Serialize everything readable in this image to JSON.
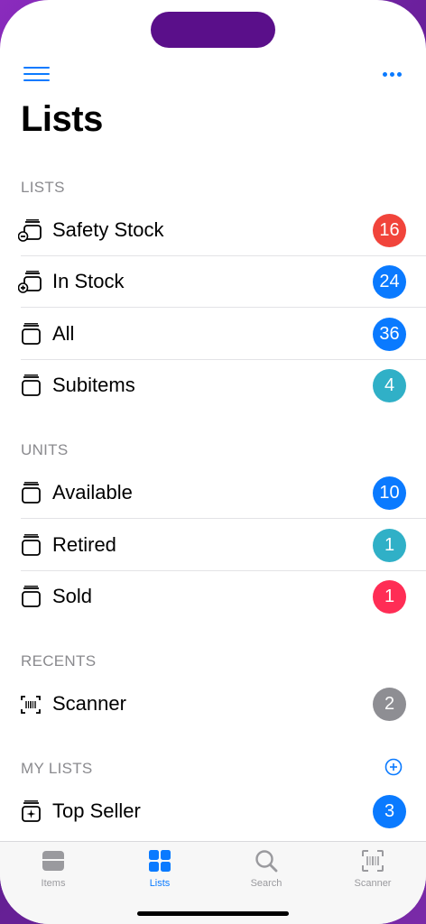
{
  "header": {
    "title": "Lists"
  },
  "sections": {
    "lists": {
      "header": "LISTS",
      "items": [
        {
          "label": "Safety Stock",
          "count": "16",
          "color": "#f1443b",
          "icon": "box-minus-icon"
        },
        {
          "label": "In Stock",
          "count": "24",
          "color": "#0a7aff",
          "icon": "box-plus-icon"
        },
        {
          "label": "All",
          "count": "36",
          "color": "#0a7aff",
          "icon": "box-icon"
        },
        {
          "label": "Subitems",
          "count": "4",
          "color": "#30b0c7",
          "icon": "box-icon"
        }
      ]
    },
    "units": {
      "header": "UNITS",
      "items": [
        {
          "label": "Available",
          "count": "10",
          "color": "#0a7aff",
          "icon": "box-icon"
        },
        {
          "label": "Retired",
          "count": "1",
          "color": "#30b0c7",
          "icon": "box-icon"
        },
        {
          "label": "Sold",
          "count": "1",
          "color": "#ff2d55",
          "icon": "box-icon"
        }
      ]
    },
    "recents": {
      "header": "RECENTS",
      "items": [
        {
          "label": "Scanner",
          "count": "2",
          "color": "#8e8e93",
          "icon": "barcode-scan-icon"
        }
      ]
    },
    "my_lists": {
      "header": "MY LISTS",
      "items": [
        {
          "label": "Top Seller",
          "count": "3",
          "color": "#0a7aff",
          "icon": "box-sparkle-icon"
        }
      ]
    }
  },
  "tabbar": {
    "tabs": [
      {
        "label": "Items",
        "active": false
      },
      {
        "label": "Lists",
        "active": true
      },
      {
        "label": "Search",
        "active": false
      },
      {
        "label": "Scanner",
        "active": false
      }
    ]
  },
  "colors": {
    "accent": "#0a7aff",
    "inactive": "#9a9a9e"
  }
}
